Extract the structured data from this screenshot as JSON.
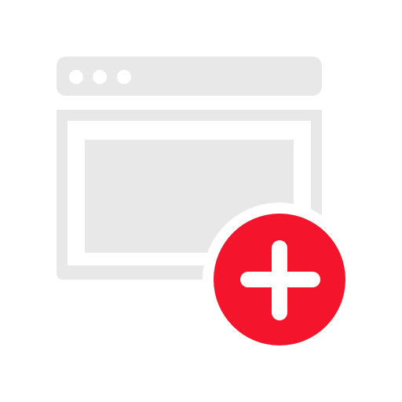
{
  "icon": {
    "name": "add-browser-window-icon",
    "colors": {
      "window_gray": "#e8e8e8",
      "background": "#ffffff",
      "badge_red": "#f4142b",
      "plus_white": "#ffffff"
    },
    "parts": {
      "window": "browser-window-icon",
      "dots": "window-control-dots",
      "content": "window-content-pane",
      "badge": "add-badge-icon",
      "plus": "plus-icon"
    }
  }
}
